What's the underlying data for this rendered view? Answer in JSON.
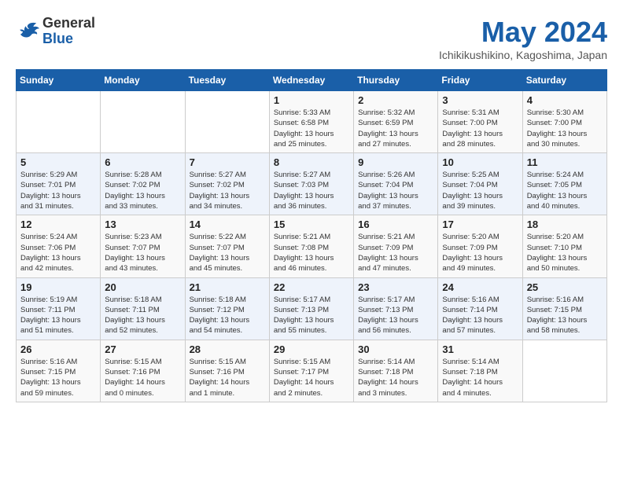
{
  "header": {
    "logo_general": "General",
    "logo_blue": "Blue",
    "month": "May 2024",
    "location": "Ichikikushikino, Kagoshima, Japan"
  },
  "weekdays": [
    "Sunday",
    "Monday",
    "Tuesday",
    "Wednesday",
    "Thursday",
    "Friday",
    "Saturday"
  ],
  "weeks": [
    [
      {
        "day": "",
        "info": ""
      },
      {
        "day": "",
        "info": ""
      },
      {
        "day": "",
        "info": ""
      },
      {
        "day": "1",
        "info": "Sunrise: 5:33 AM\nSunset: 6:58 PM\nDaylight: 13 hours\nand 25 minutes."
      },
      {
        "day": "2",
        "info": "Sunrise: 5:32 AM\nSunset: 6:59 PM\nDaylight: 13 hours\nand 27 minutes."
      },
      {
        "day": "3",
        "info": "Sunrise: 5:31 AM\nSunset: 7:00 PM\nDaylight: 13 hours\nand 28 minutes."
      },
      {
        "day": "4",
        "info": "Sunrise: 5:30 AM\nSunset: 7:00 PM\nDaylight: 13 hours\nand 30 minutes."
      }
    ],
    [
      {
        "day": "5",
        "info": "Sunrise: 5:29 AM\nSunset: 7:01 PM\nDaylight: 13 hours\nand 31 minutes."
      },
      {
        "day": "6",
        "info": "Sunrise: 5:28 AM\nSunset: 7:02 PM\nDaylight: 13 hours\nand 33 minutes."
      },
      {
        "day": "7",
        "info": "Sunrise: 5:27 AM\nSunset: 7:02 PM\nDaylight: 13 hours\nand 34 minutes."
      },
      {
        "day": "8",
        "info": "Sunrise: 5:27 AM\nSunset: 7:03 PM\nDaylight: 13 hours\nand 36 minutes."
      },
      {
        "day": "9",
        "info": "Sunrise: 5:26 AM\nSunset: 7:04 PM\nDaylight: 13 hours\nand 37 minutes."
      },
      {
        "day": "10",
        "info": "Sunrise: 5:25 AM\nSunset: 7:04 PM\nDaylight: 13 hours\nand 39 minutes."
      },
      {
        "day": "11",
        "info": "Sunrise: 5:24 AM\nSunset: 7:05 PM\nDaylight: 13 hours\nand 40 minutes."
      }
    ],
    [
      {
        "day": "12",
        "info": "Sunrise: 5:24 AM\nSunset: 7:06 PM\nDaylight: 13 hours\nand 42 minutes."
      },
      {
        "day": "13",
        "info": "Sunrise: 5:23 AM\nSunset: 7:07 PM\nDaylight: 13 hours\nand 43 minutes."
      },
      {
        "day": "14",
        "info": "Sunrise: 5:22 AM\nSunset: 7:07 PM\nDaylight: 13 hours\nand 45 minutes."
      },
      {
        "day": "15",
        "info": "Sunrise: 5:21 AM\nSunset: 7:08 PM\nDaylight: 13 hours\nand 46 minutes."
      },
      {
        "day": "16",
        "info": "Sunrise: 5:21 AM\nSunset: 7:09 PM\nDaylight: 13 hours\nand 47 minutes."
      },
      {
        "day": "17",
        "info": "Sunrise: 5:20 AM\nSunset: 7:09 PM\nDaylight: 13 hours\nand 49 minutes."
      },
      {
        "day": "18",
        "info": "Sunrise: 5:20 AM\nSunset: 7:10 PM\nDaylight: 13 hours\nand 50 minutes."
      }
    ],
    [
      {
        "day": "19",
        "info": "Sunrise: 5:19 AM\nSunset: 7:11 PM\nDaylight: 13 hours\nand 51 minutes."
      },
      {
        "day": "20",
        "info": "Sunrise: 5:18 AM\nSunset: 7:11 PM\nDaylight: 13 hours\nand 52 minutes."
      },
      {
        "day": "21",
        "info": "Sunrise: 5:18 AM\nSunset: 7:12 PM\nDaylight: 13 hours\nand 54 minutes."
      },
      {
        "day": "22",
        "info": "Sunrise: 5:17 AM\nSunset: 7:13 PM\nDaylight: 13 hours\nand 55 minutes."
      },
      {
        "day": "23",
        "info": "Sunrise: 5:17 AM\nSunset: 7:13 PM\nDaylight: 13 hours\nand 56 minutes."
      },
      {
        "day": "24",
        "info": "Sunrise: 5:16 AM\nSunset: 7:14 PM\nDaylight: 13 hours\nand 57 minutes."
      },
      {
        "day": "25",
        "info": "Sunrise: 5:16 AM\nSunset: 7:15 PM\nDaylight: 13 hours\nand 58 minutes."
      }
    ],
    [
      {
        "day": "26",
        "info": "Sunrise: 5:16 AM\nSunset: 7:15 PM\nDaylight: 13 hours\nand 59 minutes."
      },
      {
        "day": "27",
        "info": "Sunrise: 5:15 AM\nSunset: 7:16 PM\nDaylight: 14 hours\nand 0 minutes."
      },
      {
        "day": "28",
        "info": "Sunrise: 5:15 AM\nSunset: 7:16 PM\nDaylight: 14 hours\nand 1 minute."
      },
      {
        "day": "29",
        "info": "Sunrise: 5:15 AM\nSunset: 7:17 PM\nDaylight: 14 hours\nand 2 minutes."
      },
      {
        "day": "30",
        "info": "Sunrise: 5:14 AM\nSunset: 7:18 PM\nDaylight: 14 hours\nand 3 minutes."
      },
      {
        "day": "31",
        "info": "Sunrise: 5:14 AM\nSunset: 7:18 PM\nDaylight: 14 hours\nand 4 minutes."
      },
      {
        "day": "",
        "info": ""
      }
    ]
  ]
}
